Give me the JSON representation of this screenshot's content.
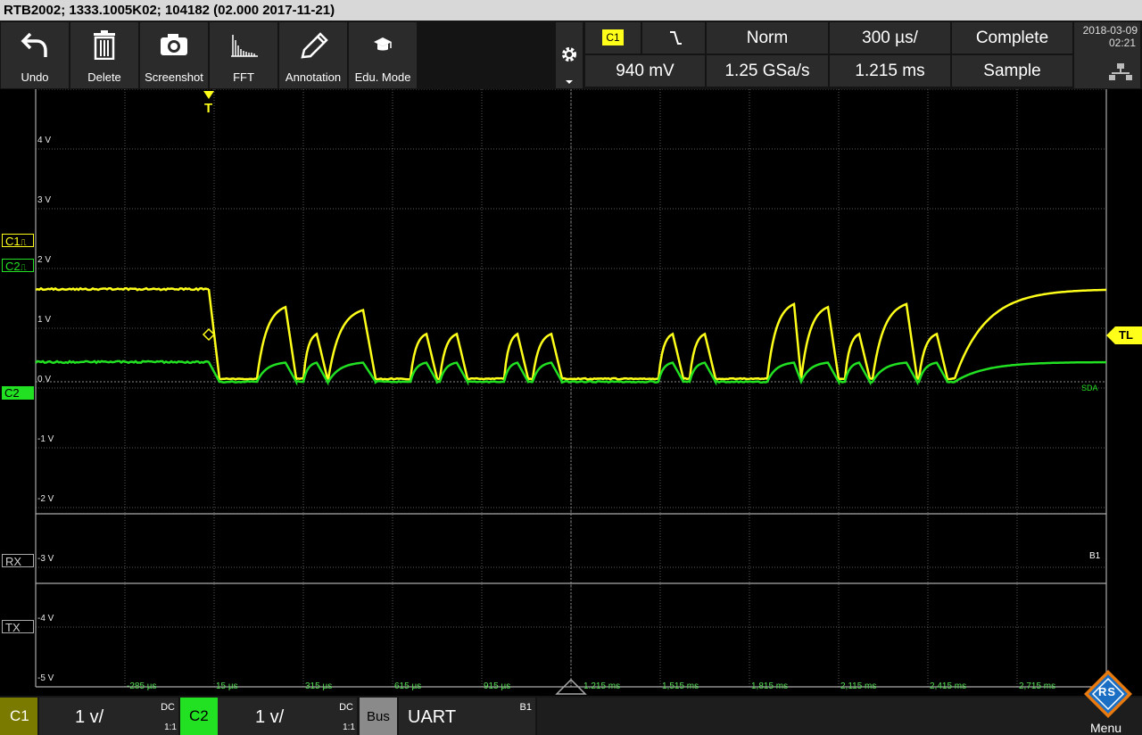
{
  "title": "RTB2002; 1333.1005K02; 104182 (02.000 2017-11-21)",
  "toolbar": {
    "undo": "Undo",
    "delete": "Delete",
    "screenshot": "Screenshot",
    "fft": "FFT",
    "annotation": "Annotation",
    "edu": "Edu. Mode"
  },
  "trigger": {
    "source": "C1",
    "slope": "\\",
    "mode": "Norm",
    "timebase": "300 µs/",
    "acq": "Complete",
    "level": "940 mV",
    "samplerate": "1.25 GSa/s",
    "position": "1.215 ms",
    "acqmode": "Sample"
  },
  "date": "2018-03-09",
  "time": "02:21",
  "levels": [
    "4 V",
    "3 V",
    "2 V",
    "1 V",
    "0 V",
    "-1 V",
    "-2 V",
    "-3 V",
    "-4 V",
    "-5 V"
  ],
  "time_ticks": [
    "-285 µs",
    "15 µs",
    "315 µs",
    "615 µs",
    "915 µs",
    "1.215 ms",
    "1,515 ms",
    "1,815 ms",
    "2,115 ms",
    "2,415 ms",
    "2,715 ms"
  ],
  "markers": {
    "c1": "C1",
    "c2": "C2",
    "c2_ground": "C2",
    "rx": "RX",
    "tx": "TX",
    "trigger_t": "T",
    "tl": "TL",
    "sda": "SDA",
    "b1": "B1",
    "glyph": "⎍"
  },
  "bottom": {
    "c1_label": "C1",
    "c1_scale": "1 v/",
    "c1_coupling": "DC",
    "c1_probe": "1:1",
    "c2_label": "C2",
    "c2_scale": "1 v/",
    "c2_coupling": "DC",
    "c2_probe": "1:1",
    "bus_label": "Bus",
    "bus_type": "UART",
    "bus_id": "B1",
    "menu": "Menu",
    "logo": "RS"
  },
  "colors": {
    "ch1": "#ffff1a",
    "ch2": "#22e022",
    "bg": "#000000",
    "grid": "#5a5a5a"
  }
}
